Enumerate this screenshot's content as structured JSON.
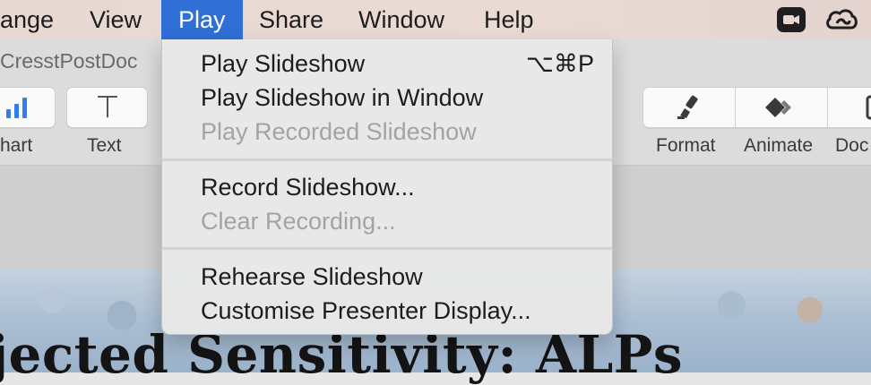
{
  "menubar": {
    "items": [
      "ange",
      "View",
      "Play",
      "Share",
      "Window",
      "Help"
    ],
    "active": "Play",
    "status_icons": [
      "video-icon",
      "creative-cloud-icon"
    ]
  },
  "window": {
    "doc_title": "CresstPostDoc"
  },
  "toolbar": {
    "left": [
      {
        "label": "hart",
        "icon": "chart-icon"
      },
      {
        "label": "Text",
        "icon": "text-icon"
      }
    ],
    "right": [
      {
        "label": "Format",
        "icon": "paintbrush-icon"
      },
      {
        "label": "Animate",
        "icon": "animate-diamond-icon"
      },
      {
        "label": "Doc",
        "icon": "document-icon"
      }
    ]
  },
  "slide": {
    "heading": "jected Sensitivity: ALPs"
  },
  "play_menu": {
    "items": [
      {
        "label": "Play Slideshow",
        "shortcut": "⌥⌘P",
        "enabled": true
      },
      {
        "label": "Play Slideshow in Window",
        "enabled": true
      },
      {
        "label": "Play Recorded Slideshow",
        "enabled": false
      },
      {
        "label": "Record Slideshow...",
        "enabled": true
      },
      {
        "label": "Clear Recording...",
        "enabled": false
      },
      {
        "label": "Rehearse Slideshow",
        "enabled": true
      },
      {
        "label": "Customise Presenter Display...",
        "enabled": true
      }
    ]
  },
  "colors": {
    "menu_highlight": "#2f6fd6",
    "accent_blue": "#2f7df0"
  }
}
